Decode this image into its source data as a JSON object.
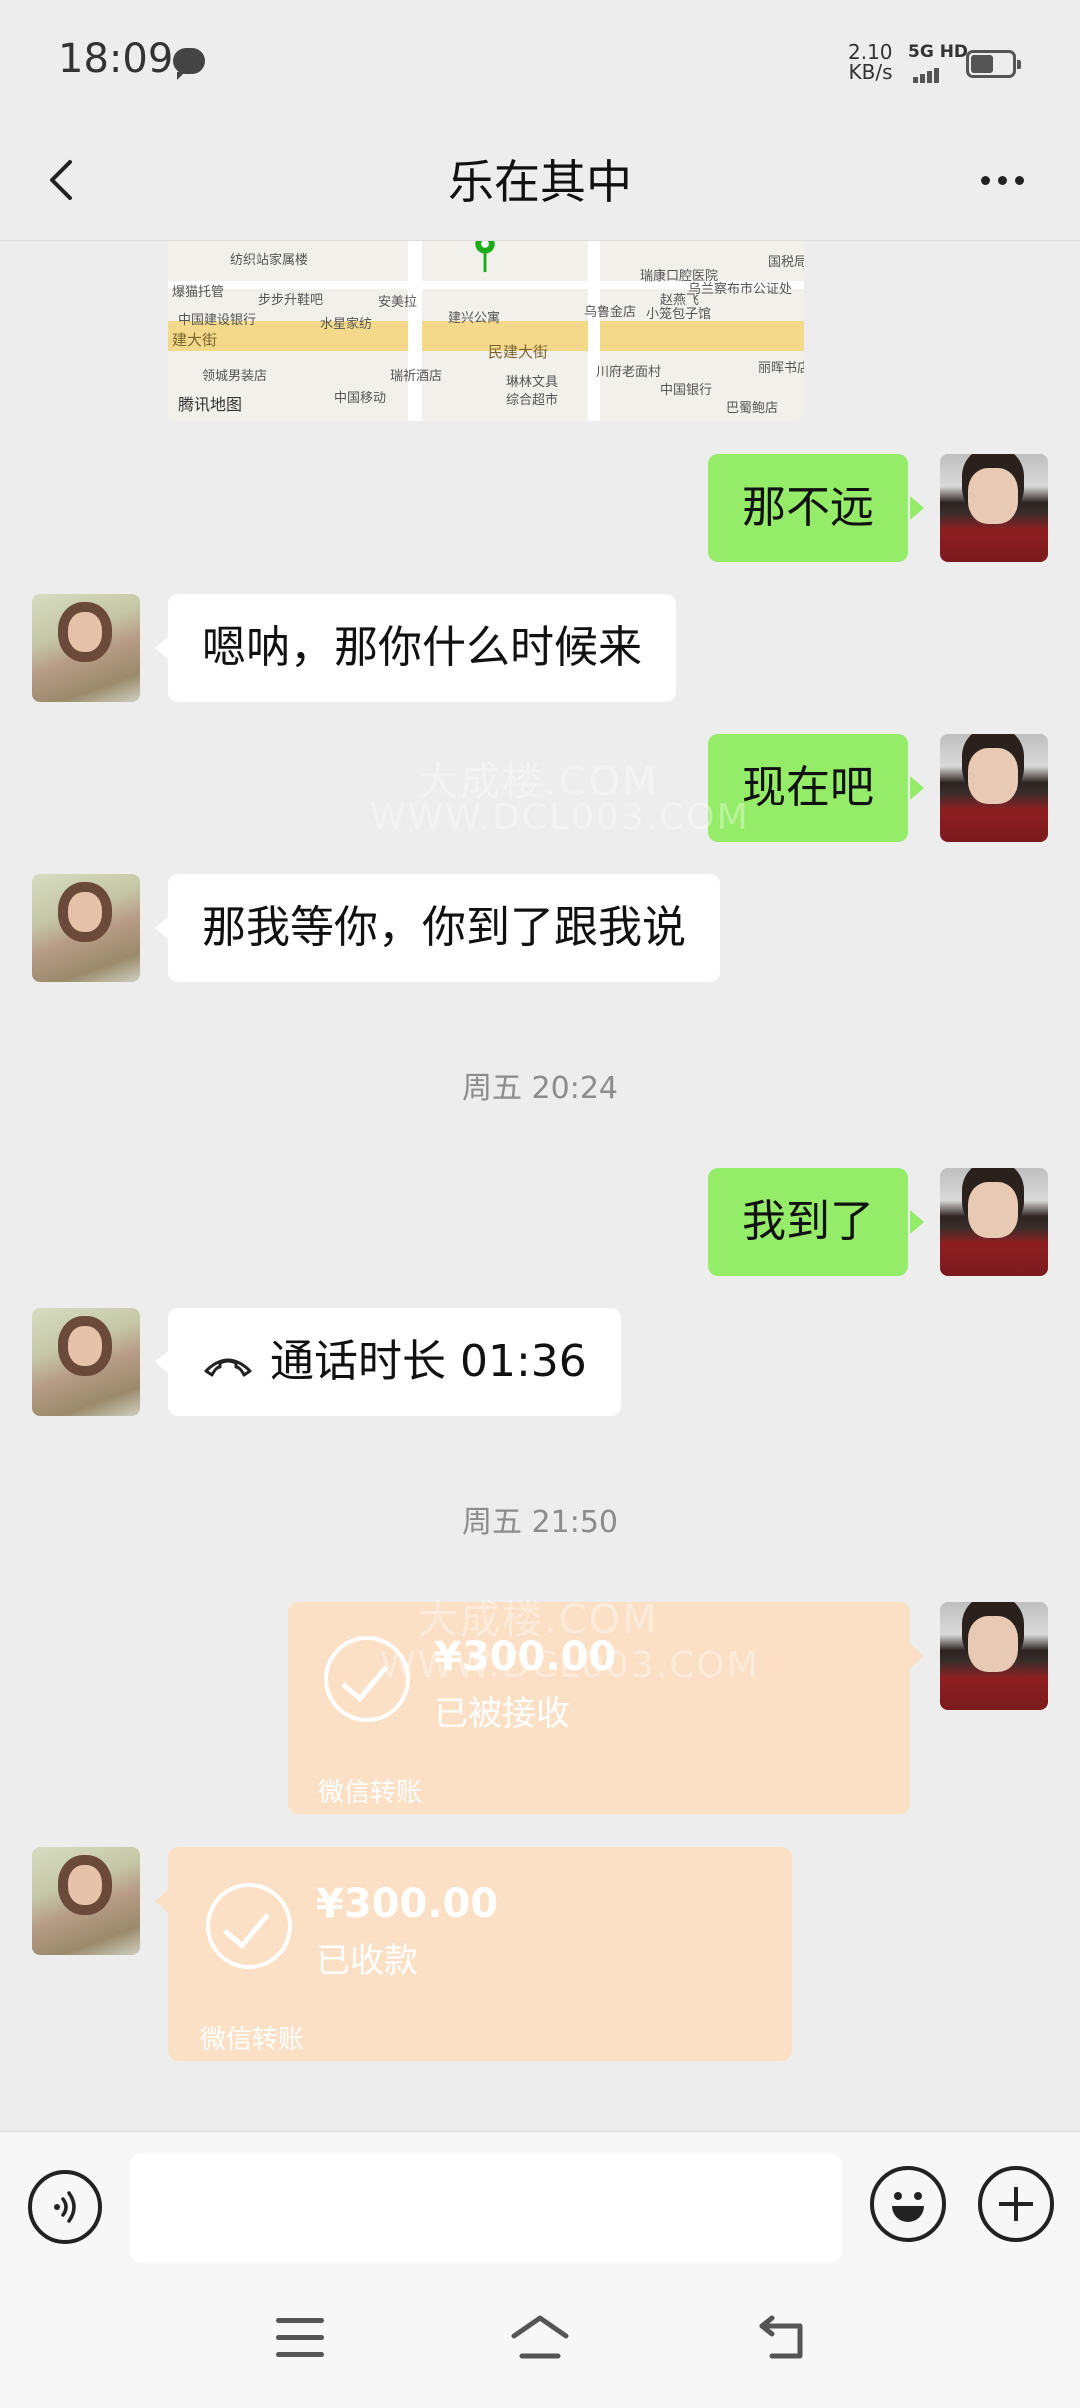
{
  "status_bar": {
    "time": "18:09",
    "net_speed_value": "2.10",
    "net_speed_unit": "KB/s",
    "network_type": "5G HD"
  },
  "header": {
    "title": "乐在其中"
  },
  "map": {
    "labels": [
      "纺织站家属楼",
      "步步升鞋吧",
      "中国建设银行",
      "安美拉",
      "水星家纺",
      "建兴公寓",
      "乌鲁金店",
      "赵燕飞",
      "小笼包子馆",
      "领城男装店",
      "瑞祈酒店",
      "中国移动",
      "琳林文具",
      "综合超市",
      "川府老面村",
      "中国银行",
      "巴蜀鲍店",
      "瑞康口腔医院",
      "乌兰察布市公证处",
      "国税局",
      "丽晖书店",
      "爆猫托管"
    ],
    "road_main": "民建大街",
    "road_left": "建大街",
    "attribution": "腾讯地图"
  },
  "messages": {
    "m1": "那不远",
    "m2": "嗯呐，那你什么时候来",
    "m3": "现在吧",
    "m4": "那我等你，你到了跟我说",
    "ts1": "周五 20:24",
    "m5": "我到了",
    "call_text": "通话时长 01:36",
    "ts2": "周五 21:50"
  },
  "transfers": {
    "sent": {
      "amount": "¥300.00",
      "status": "已被接收",
      "label": "微信转账"
    },
    "received": {
      "amount": "¥300.00",
      "status": "已收款",
      "label": "微信转账"
    }
  },
  "watermark": {
    "line1": "大成楼.COM",
    "line2": "WWW.DCL003.COM"
  },
  "input": {
    "value": "",
    "placeholder": ""
  },
  "colors": {
    "outgoing_bubble": "#95ec69",
    "incoming_bubble": "#ffffff",
    "transfer_card": "#fbe0c6",
    "background": "#ededed"
  }
}
